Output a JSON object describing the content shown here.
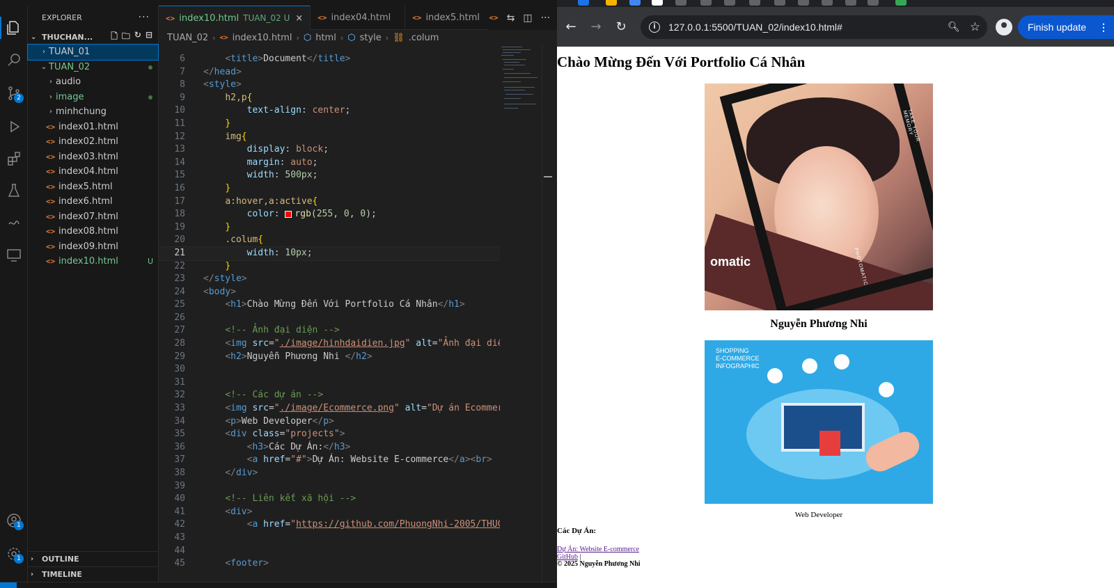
{
  "vscode": {
    "explorer": {
      "title": "EXPLORER",
      "more": "···",
      "root": "THUCHAN...",
      "items": [
        {
          "label": "TUAN_01",
          "kind": "folder",
          "expanded": false,
          "selected": true,
          "status": ""
        },
        {
          "label": "TUAN_02",
          "kind": "folder",
          "expanded": true,
          "selected": false,
          "status": "dot"
        },
        {
          "label": "audio",
          "kind": "folder",
          "expanded": false,
          "status": ""
        },
        {
          "label": "image",
          "kind": "folder",
          "expanded": false,
          "status": "dot"
        },
        {
          "label": "minhchung",
          "kind": "folder",
          "expanded": false,
          "status": ""
        },
        {
          "label": "index01.html",
          "kind": "file",
          "status": ""
        },
        {
          "label": "index02.html",
          "kind": "file",
          "status": ""
        },
        {
          "label": "index03.html",
          "kind": "file",
          "status": ""
        },
        {
          "label": "index04.html",
          "kind": "file",
          "status": ""
        },
        {
          "label": "index5.html",
          "kind": "file",
          "status": ""
        },
        {
          "label": "index6.html",
          "kind": "file",
          "status": ""
        },
        {
          "label": "index07.html",
          "kind": "file",
          "status": ""
        },
        {
          "label": "index08.html",
          "kind": "file",
          "status": ""
        },
        {
          "label": "index09.html",
          "kind": "file",
          "status": ""
        },
        {
          "label": "index10.html",
          "kind": "file",
          "status": "U"
        }
      ],
      "outline": "OUTLINE",
      "timeline": "TIMELINE"
    },
    "activity_badges": {
      "scm": "2",
      "accounts": "1",
      "settings": "1"
    },
    "tabs": [
      {
        "label": "index10.html",
        "path": "TUAN_02 U",
        "active": true
      },
      {
        "label": "index04.html",
        "path": "",
        "active": false
      },
      {
        "label": "index5.html",
        "path": "",
        "active": false
      }
    ],
    "breadcrumb": [
      "TUAN_02",
      "index10.html",
      "html",
      "style",
      ".colum"
    ],
    "current_line": 21,
    "colors": {
      "accent": "#0078d4",
      "untracked": "#73c991",
      "html_icon": "#e37933"
    }
  },
  "chrome": {
    "url": "127.0.0.1:5500/TUAN_02/index10.html#",
    "finish_update": "Finish update",
    "page": {
      "heading": "Chào Mừng Đến Với Portfolio Cá Nhân",
      "avatar_brand": "omatic",
      "avatar_side_text": "TAKE YOUR MEMORY",
      "avatar_side_text2": "PHOTOMATIC",
      "name": "Nguyễn Phương Nhi",
      "ecom_label": "SHOPPING\nE-COMMERCE\nINFOGRAPHIC",
      "role": "Web Developer",
      "projects_heading": "Các Dự Án:",
      "project_link": "Dự Án: Website E-commerce",
      "github_link": "GitHub",
      "github_sep": " |",
      "footer": "© 2025 Nguyễn Phương Nhi"
    }
  }
}
